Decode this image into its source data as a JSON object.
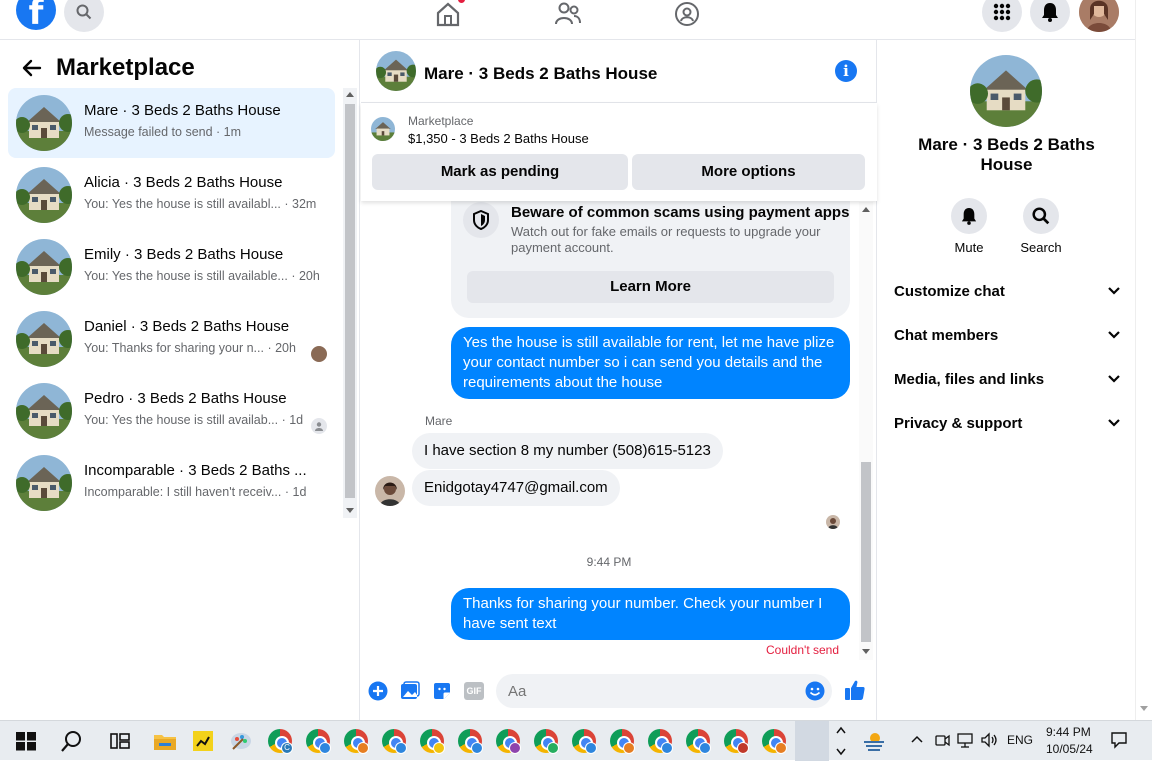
{
  "topnav": {
    "logo": "f"
  },
  "left": {
    "title": "Marketplace",
    "conversations": [
      {
        "name": "Mare · 3 Beds 2 Baths House",
        "preview": "Message failed to send · 1m"
      },
      {
        "name": "Alicia · 3 Beds 2 Baths House",
        "preview": "You: Yes the house is still availabl... · 32m"
      },
      {
        "name": "Emily · 3 Beds 2 Baths House",
        "preview": "You: Yes the house is still available... · 20h"
      },
      {
        "name": "Daniel · 3 Beds 2 Baths House",
        "preview": "You: Thanks for sharing your n... · 20h"
      },
      {
        "name": "Pedro · 3 Beds 2 Baths House",
        "preview": "You: Yes the house is still availab... · 1d"
      },
      {
        "name": "Incomparable · 3 Beds 2 Baths ...",
        "preview": "Incomparable: I still haven't receiv... · 1d"
      }
    ]
  },
  "chat": {
    "header_name": "Mare · 3 Beds 2 Baths House",
    "info_glyph": "i",
    "marketplace_label": "Marketplace",
    "listing": "$1,350 - 3 Beds 2 Baths House",
    "mark_pending": "Mark as pending",
    "more_options": "More options",
    "scam_title": "Beware of common scams using payment apps",
    "scam_body": "Watch out for fake emails or requests to upgrade your payment account.",
    "learn_more": "Learn More",
    "msg_out_1": "Yes the house is still available  for rent, let me have plize your contact number so i can send you details and the requirements about the house",
    "sender": "Mare",
    "msg_in_1": "I have section 8 my number (508)615-5123",
    "msg_in_2": "Enidgotay4747@gmail.com",
    "timestamp": "9:44 PM",
    "msg_out_2": "Thanks for sharing your number.  Check your number I have sent text",
    "failed": "Couldn't send",
    "composer_placeholder": "Aa",
    "gif_label": "GIF"
  },
  "right": {
    "name": "Mare · 3 Beds 2 Baths House",
    "mute": "Mute",
    "search": "Search",
    "rows": [
      "Customize chat",
      "Chat members",
      "Media, files and links",
      "Privacy & support"
    ]
  },
  "taskbar": {
    "lang": "ENG",
    "time": "9:44 PM",
    "date": "10/05/24",
    "badge_letter": "C"
  },
  "colors": {
    "accent": "#1877f2",
    "bubble": "#0084ff",
    "error": "#e41e3f"
  }
}
